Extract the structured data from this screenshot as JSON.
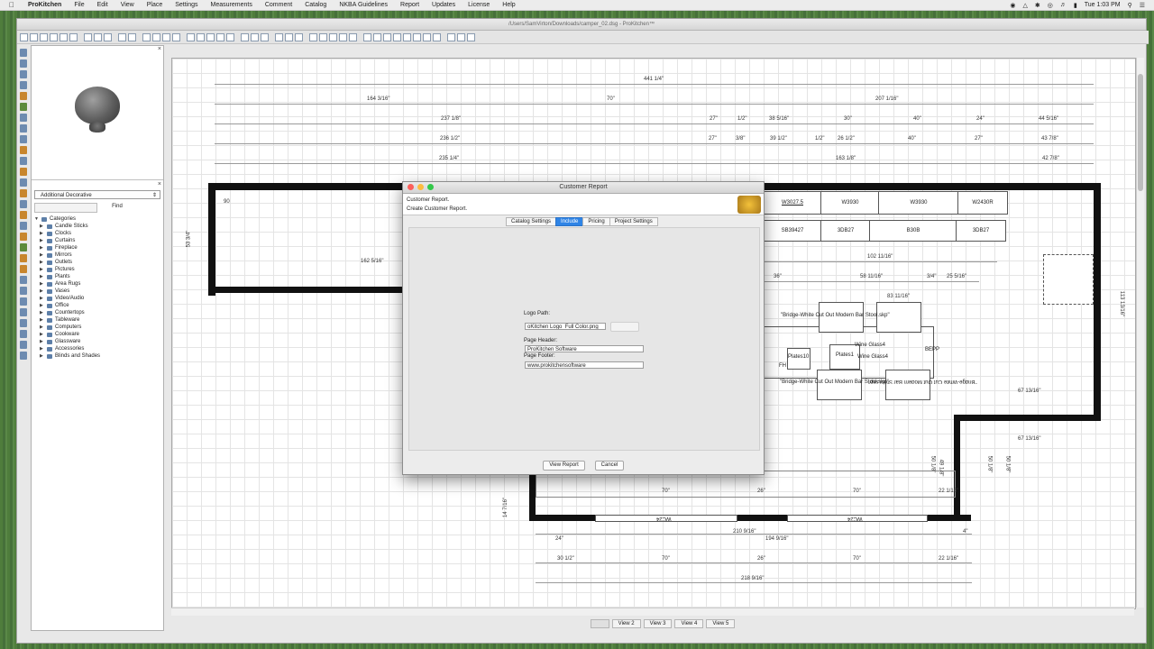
{
  "menubar": {
    "app_name": "ProKitchen",
    "items": [
      "File",
      "Edit",
      "View",
      "Place",
      "Settings",
      "Measurements",
      "Comment",
      "Catalog",
      "NKBA Guidelines",
      "Report",
      "Updates",
      "License",
      "Help"
    ],
    "clock": "Tue 1:03 PM"
  },
  "window": {
    "title": "/Users/SamVirton/Downloads/camper_02.dsg - ProKitchen™"
  },
  "catalog_panel": {
    "category_select": "Additional Decorative",
    "find_label": "Find",
    "tree_root": "Categories",
    "categories": [
      "Candle Sticks",
      "Clocks",
      "Curtains",
      "Fireplace",
      "Mirrors",
      "Outlets",
      "Pictures",
      "Plants",
      "Area Rugs",
      "Vases",
      "Video/Audio",
      "Office",
      "Countertops",
      "Tableware",
      "Computers",
      "Cookware",
      "Glassware",
      "Accessories",
      "Blinds and Shades"
    ]
  },
  "view_tabs": [
    "View 2",
    "View 3",
    "View 4",
    "View 5"
  ],
  "floorplan": {
    "dims": {
      "overall": "441 1/4\"",
      "d1": "164 3/16\"",
      "d2": "70\"",
      "d3": "207 1/16\"",
      "d4": "237 1/8\"",
      "d5": "27\"",
      "d6": "1/2\"",
      "d7": "38 5/16\"",
      "d8": "30\"",
      "d9": "40\"",
      "d10": "24\"",
      "d11": "44 5/16\"",
      "d12": "236 1/2\"",
      "d13": "27\"",
      "d14": "3/8\"",
      "d15": "39 1/2\"",
      "d16": "1/2\"",
      "d17": "26 1/2\"",
      "d18": "40\"",
      "d19": "27\"",
      "d20": "43 7/8\"",
      "d21": "235 1/4\"",
      "d22": "163 1/8\"",
      "d23": "42 7/8\"",
      "left_h": "53 3/4\"",
      "room_w": "162 5/16\"",
      "room_n": "90",
      "d24": "102 11/16\"",
      "d25": "36\"",
      "d26": "58 11/16\"",
      "d27": "3/4\"",
      "d28": "25 5/16\"",
      "d29": "83 11/16\"",
      "right_v": "113 13/16\"",
      "d30": "67 13/16\"",
      "d31": "67 13/16\"",
      "b1": "70\"",
      "b2": "26\"",
      "b3": "70\"",
      "b4": "22 1/16\"",
      "b5": "210 9/16\"",
      "b6": "24\"",
      "b7": "194 9/16\"",
      "b8": "4\"",
      "b9": "30 1/2\"",
      "b10": "70\"",
      "b11": "26\"",
      "b12": "70\"",
      "b13": "22 1/16\"",
      "b14": "218 9/16\"",
      "v1": "14 7/16\"",
      "v2": "50 1/8\"",
      "v3": "49 1/8\"",
      "v4": "50 1/8\"",
      "v5": "50 1/8\""
    },
    "cabinets": {
      "w3027": "W3027.5",
      "w3930a": "W3930",
      "w3930b": "W3930",
      "w2430r": "W2430R",
      "sb": "SB39427",
      "b3db27a": "3DB27",
      "b30b": "B30B",
      "b3db27b": "3DB27",
      "wc24a": "WC24",
      "wc24b": "WC24"
    },
    "labels": {
      "stool1": "\"Bridge-White Cut Out Modern Bar Stool.skp\"",
      "stool_overlap": "Wine Glass4",
      "plates10": "Plates10",
      "plates1": "Plates1",
      "wineglass": "Wine Glass4",
      "bepp": "BEPP",
      "fh": "FH",
      "stool2": "\"Bridge-White Cut Out Modern Bar Stool.skp\"",
      "stool3": "\"Bridge-White Cut Out Modern Bar Stool.skp\""
    }
  },
  "dialog": {
    "title": "Customer Report",
    "header_line1": "Customer Report.",
    "header_line2": "Create Customer Report.",
    "tabs": [
      "Catalog Settings",
      "Include",
      "Pricing",
      "Project Settings"
    ],
    "logo_path_label": "Logo Path:",
    "logo_path_value": "oKitchen Logo_Full Color.png",
    "page_header_label": "Page Header:",
    "page_header_value": "ProKitchen Software",
    "page_footer_label": "Page Footer:",
    "page_footer_value": "www.prokitchensoftware",
    "view_report_label": "View Report",
    "cancel_label": "Cancel"
  },
  "colors": {
    "accent": "#2f84e6",
    "close_light": "#fc605c",
    "min_light": "#fdbc40",
    "max_light": "#34c84a"
  }
}
